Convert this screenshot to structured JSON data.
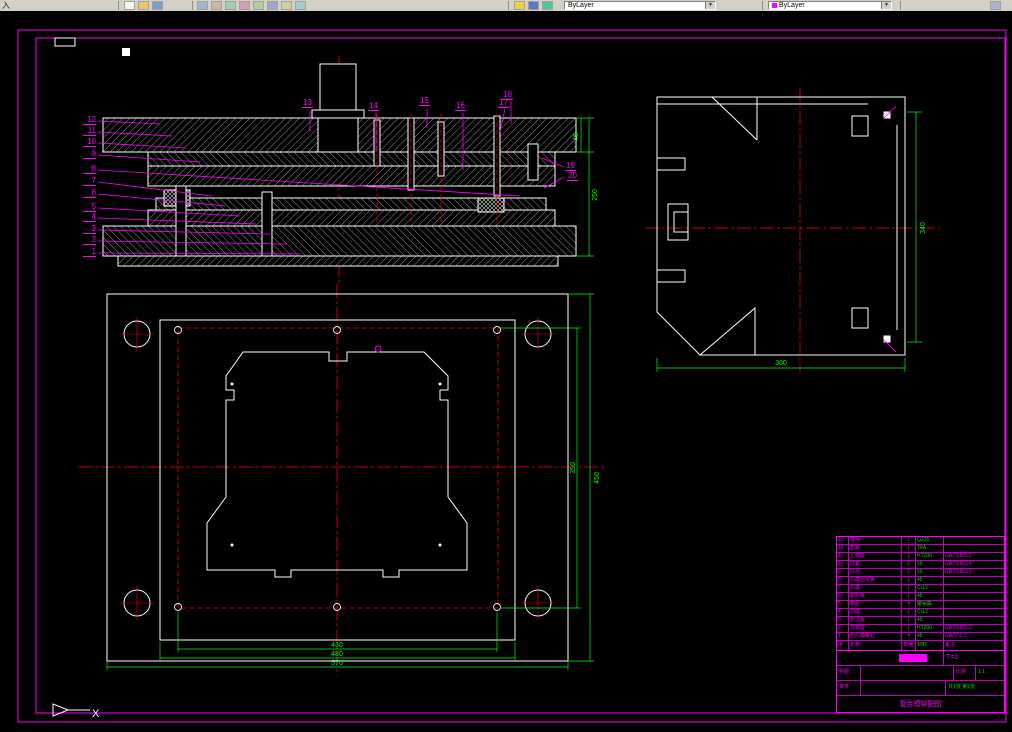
{
  "colors": {
    "canvas_bg": "#000000",
    "frame": "#ff00ff",
    "geometry": "#ffffff",
    "centerline": "#ff0000",
    "dimension": "#00ff00",
    "callout": "#ff00ff",
    "toolbar_bg": "#d4d0c8"
  },
  "toolbar": {
    "fragment_label": "入",
    "icon_names": [
      "new-icon",
      "open-icon",
      "save-icon",
      "erase-icon",
      "copy-icon",
      "mirror-icon",
      "offset-icon",
      "array-icon",
      "move-icon",
      "rotate-icon",
      "trim-icon",
      "zoom-window-icon",
      "zoom-prev-icon",
      "pan-icon",
      "plot-icon"
    ],
    "layer_combo_value": "ByLayer",
    "color_combo_value": "ByLayer"
  },
  "drawing": {
    "section_view": {
      "callouts_left": [
        "12",
        "11",
        "10",
        "9",
        "8",
        "7",
        "6",
        "5",
        "4",
        "3",
        "2",
        "1"
      ],
      "callouts_top": [
        "13",
        "14",
        "15",
        "16",
        "17",
        "18"
      ],
      "callouts_right": [
        "19",
        "20"
      ],
      "dim_thickness": "45",
      "dim_height": "250"
    },
    "side_view": {
      "dim_height": "340",
      "dim_width": "300"
    },
    "plan_view": {
      "dim_inner": "430",
      "dim_mid": "480",
      "dim_outer": "570",
      "dim_right_inner": "350",
      "dim_right_outer": "450"
    },
    "ucs_label": "X"
  },
  "title_block": {
    "columns": [
      "序号",
      "名称",
      "数量",
      "材料",
      "备注"
    ],
    "rows": [
      {
        "no": "13",
        "name": "模柄",
        "qty": "1",
        "material": "Q235",
        "standard": ""
      },
      {
        "no": "12",
        "name": "垫板",
        "qty": "1",
        "material": "T8A",
        "standard": ""
      },
      {
        "no": "11",
        "name": "上模座",
        "qty": "1",
        "material": "HT200",
        "standard": "GB/T2855.1"
      },
      {
        "no": "10",
        "name": "导套",
        "qty": "2",
        "material": "20",
        "standard": "GB/T2861.6"
      },
      {
        "no": "9",
        "name": "导柱",
        "qty": "2",
        "material": "20",
        "standard": "GB/T2861.1"
      },
      {
        "no": "8",
        "name": "凸模固定板",
        "qty": "1",
        "material": "45",
        "standard": ""
      },
      {
        "no": "7",
        "name": "凸模",
        "qty": "1",
        "material": "Cr12",
        "standard": ""
      },
      {
        "no": "6",
        "name": "卸料板",
        "qty": "1",
        "material": "45",
        "standard": ""
      },
      {
        "no": "5",
        "name": "橡胶",
        "qty": "4",
        "material": "聚氨酯",
        "standard": ""
      },
      {
        "no": "4",
        "name": "凹模",
        "qty": "1",
        "material": "Cr12",
        "standard": ""
      },
      {
        "no": "3",
        "name": "定位板",
        "qty": "1",
        "material": "45",
        "standard": ""
      },
      {
        "no": "2",
        "name": "下模座",
        "qty": "1",
        "material": "HT200",
        "standard": "GB/T2855.2"
      },
      {
        "no": "1",
        "name": "内六角螺钉",
        "qty": "4",
        "material": "45",
        "standard": "GB/T70.1"
      }
    ],
    "stamp": "T=1",
    "labels": {
      "draw": "制图",
      "check": "审核",
      "scale_label": "比例",
      "scale": "1:1",
      "sheet": "共1张 第1张",
      "title": "复合模装配图"
    }
  }
}
